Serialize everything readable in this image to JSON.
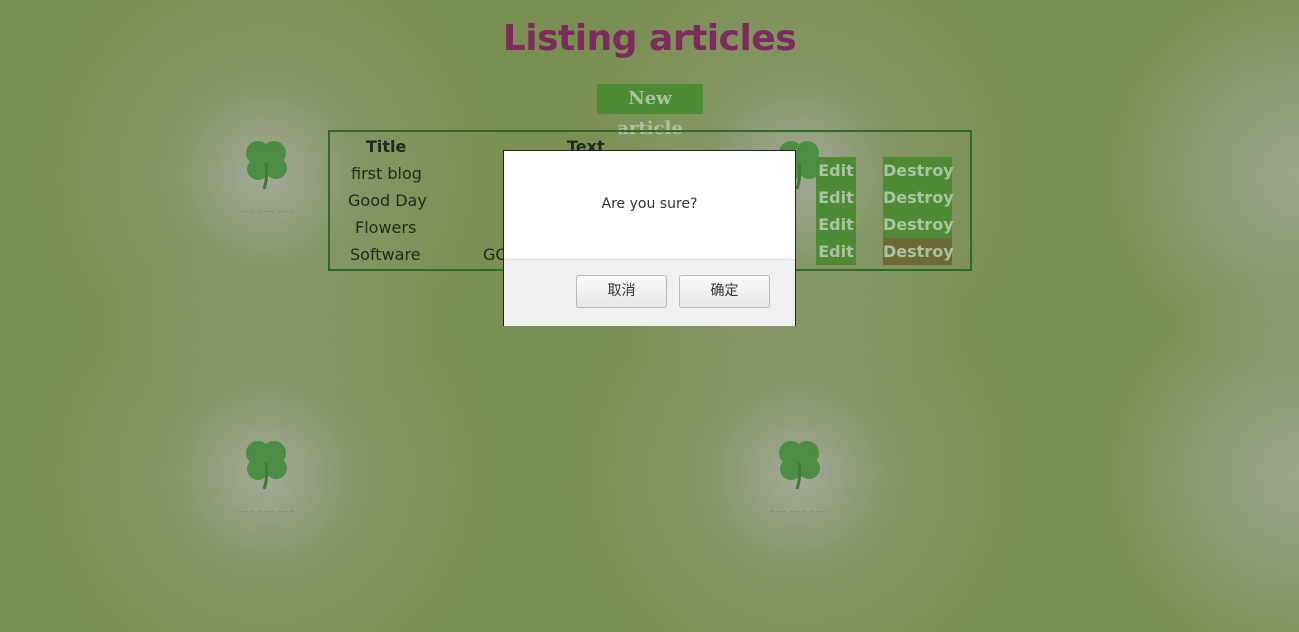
{
  "page": {
    "title": "Listing articles",
    "new_article_label": "New article"
  },
  "table": {
    "headers": {
      "title": "Title",
      "text": "Text"
    },
    "rows": [
      {
        "title": "first blog",
        "text": "",
        "edit": "Edit",
        "destroy": "Destroy"
      },
      {
        "title": "Good Day",
        "text": "",
        "edit": "Edit",
        "destroy": "Destroy"
      },
      {
        "title": "Flowers",
        "text": "",
        "edit": "Edit",
        "destroy": "Destroy"
      },
      {
        "title": "Software",
        "text": "GC",
        "edit": "Edit",
        "destroy": "Destroy"
      }
    ]
  },
  "dialog": {
    "message": "Are you sure?",
    "cancel_label": "取消",
    "ok_label": "确定"
  },
  "colors": {
    "background": "#7a8f52",
    "title": "#7d2a5e",
    "button_bg": "#4f8a35",
    "button_text": "#a9c4a0",
    "button_hover_bg": "#6e6a35",
    "table_border": "#2e6a2a"
  }
}
